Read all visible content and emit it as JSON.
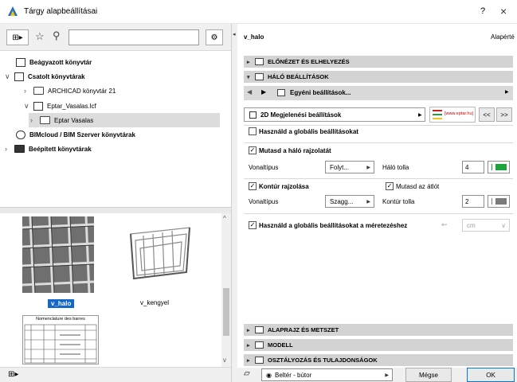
{
  "window": {
    "title": "Tárgy alapbeállításai",
    "help_label": "?",
    "close_label": "×"
  },
  "left": {
    "search": {
      "value": "",
      "placeholder": ""
    },
    "tree": [
      {
        "label": "Beágyazott könyvtár"
      },
      {
        "label": "Csatolt könyvtárak"
      },
      {
        "label": "ARCHICAD könyvtár 21"
      },
      {
        "label": "Eptar_Vasalas.lcf"
      },
      {
        "label": "Eptar Vasalas"
      },
      {
        "label": "BIMcloud / BIM Szerver könyvtárak"
      },
      {
        "label": "Beépített könyvtárak"
      }
    ],
    "thumbs": [
      {
        "label": "v_halo"
      },
      {
        "label": "v_kengyel"
      },
      {
        "label": "Nomenclature des barres"
      }
    ]
  },
  "right": {
    "object_name": "v_halo",
    "default_label": "Alapérté",
    "sections": {
      "preview": "ELŐNÉZET ÉS ELHELYEZÉS",
      "mesh": "HÁLÓ BEÁLLÍTÁSOK",
      "plan": "ALAPRAJZ ÉS METSZET",
      "model": "MODELL",
      "classification": "OSZTÁLYOZÁS ÉS TULAJDONSÁGOK"
    },
    "custom_settings": "Egyéni beállítások...",
    "display_settings": "2D Megjelenési beállítások",
    "eptar_logo": "[www.eptar.hu]",
    "nav_prev": "<<",
    "nav_next": ">>",
    "use_global": {
      "label": "Használd a globális beállításokat",
      "checked": false
    },
    "show_mesh": {
      "label": "Mutasd a háló rajzolatát",
      "checked": true
    },
    "line_type_1": {
      "label": "Vonaltípus",
      "value": "Folyt..."
    },
    "mesh_pen": {
      "label": "Háló tolla",
      "value": "4",
      "color": "#1fa33a"
    },
    "contour": {
      "label": "Kontúr rajzolása",
      "checked": true
    },
    "show_diagonal": {
      "label": "Mutasd az átlót",
      "checked": true
    },
    "line_type_2": {
      "label": "Vonaltípus",
      "value": "Szagg..."
    },
    "contour_pen": {
      "label": "Kontúr tolla",
      "value": "2",
      "color": "#7a7a7a"
    },
    "use_global_dim": {
      "label": "Használd a globális beállításokat a méretezéshez",
      "checked": true
    },
    "unit": {
      "value": "cm"
    },
    "layer": "Beltér - bútor",
    "cancel": "Mégse",
    "ok": "OK"
  }
}
